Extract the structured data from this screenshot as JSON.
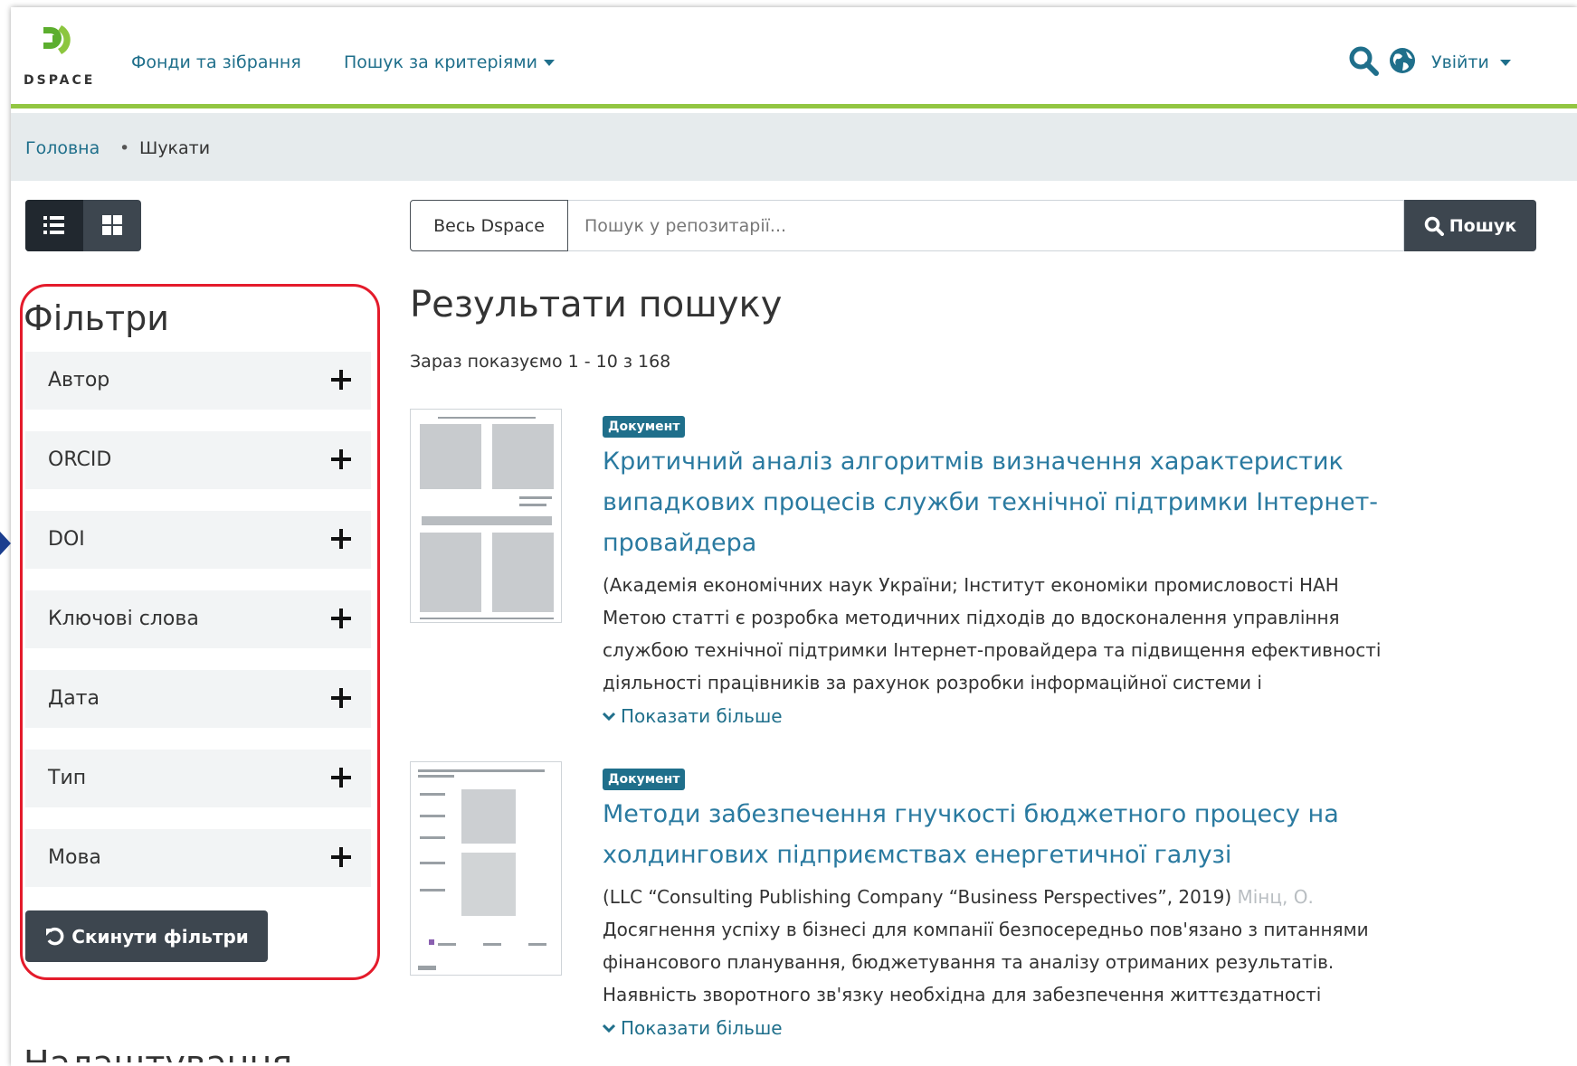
{
  "colors": {
    "accent": "#1f6f8b",
    "header_border": "#92c642",
    "dark_button": "#3d464f",
    "highlight": "#e41b2b"
  },
  "header": {
    "logo_text": "DSPACE",
    "nav": {
      "communities": "Фонди та зібрання",
      "browse": "Пошук за критеріями"
    },
    "icons": [
      "search-icon",
      "globe-icon"
    ],
    "login": "Увійти"
  },
  "breadcrumb": {
    "home": "Головна",
    "separator": "•",
    "current": "Шукати"
  },
  "view_toggle": {
    "icons": [
      "list-view-icon",
      "grid-view-icon"
    ],
    "active": "list"
  },
  "search": {
    "scope": "Весь Dspace",
    "placeholder": "Пошук у репозитарії...",
    "button": "Пошук"
  },
  "filters": {
    "title": "Фільтри",
    "items": [
      "Автор",
      "ORCID",
      "DOI",
      "Ключові слова",
      "Дата",
      "Тип",
      "Мова"
    ],
    "reset": "Скинути фільтри",
    "next_section_title": "Налаштування"
  },
  "results": {
    "title": "Результати пошуку",
    "count": "Зараз показуємо 1 - 10 з 168",
    "show_more": "Показати більше",
    "items": [
      {
        "badge": "Документ",
        "title_lines": [
          "Критичний аналіз алгоритмів визначення характеристик",
          "випадкових процесів служби технічної підтримки Інтернет-",
          "провайдера"
        ],
        "meta": "(Академія економічних наук України; Інститут економіки промисловості НАН",
        "meta_fade": "",
        "abstract_lines": [
          "Метою статті є розробка методичних підходів до вдосконалення управління",
          "службою технічної підтримки Інтернет-провайдера та підвищення ефективності",
          "діяльності працівників за рахунок розробки інформаційної системи і"
        ]
      },
      {
        "badge": "Документ",
        "title_lines": [
          "Методи забезпечення гнучкості бюджетного процесу на",
          "холдингових підприємствах енергетичної галузі"
        ],
        "meta": "(LLC “Consulting Publishing Company “Business Perspectives”, 2019)",
        "meta_fade": "Мінц, О.",
        "abstract_lines": [
          "Досягнення успіху в бізнесі для компанії безпосередньо пов'язано з питаннями",
          "фінансового планування, бюджетування та аналізу отриманих результатів.",
          "Наявність зворотного зв'язку необхідна для забезпечення життєздатності"
        ]
      }
    ]
  }
}
